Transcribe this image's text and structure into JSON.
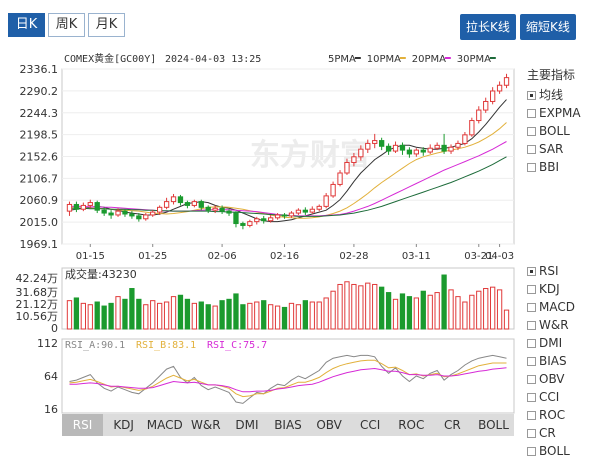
{
  "period_tabs": [
    {
      "label": "日K",
      "active": true
    },
    {
      "label": "周K",
      "active": false
    },
    {
      "label": "月K",
      "active": false
    }
  ],
  "buttons": {
    "extend": "拉长K线",
    "shorten": "缩短K线"
  },
  "header": {
    "symbol": "COMEX黄金[GC00Y]",
    "datetime": "2024-04-03 13:25"
  },
  "ma_legend": [
    {
      "label": "5PMA",
      "color": "#333333"
    },
    {
      "label": "10PMA",
      "color": "#e2b13c"
    },
    {
      "label": "20PMA",
      "color": "#d62ad6"
    },
    {
      "label": "30PMA",
      "color": "#1d6b3a"
    }
  ],
  "main_indicators": {
    "title": "主要指标",
    "items": [
      {
        "label": "均线",
        "checked": true
      },
      {
        "label": "EXPMA",
        "checked": false
      },
      {
        "label": "BOLL",
        "checked": false
      },
      {
        "label": "SAR",
        "checked": false
      },
      {
        "label": "BBI",
        "checked": false
      }
    ]
  },
  "sub_indicators": [
    {
      "label": "RSI",
      "checked": true
    },
    {
      "label": "KDJ",
      "checked": false
    },
    {
      "label": "MACD",
      "checked": false
    },
    {
      "label": "W&R",
      "checked": false
    },
    {
      "label": "DMI",
      "checked": false
    },
    {
      "label": "BIAS",
      "checked": false
    },
    {
      "label": "OBV",
      "checked": false
    },
    {
      "label": "CCI",
      "checked": false
    },
    {
      "label": "ROC",
      "checked": false
    },
    {
      "label": "CR",
      "checked": false
    },
    {
      "label": "BOLL",
      "checked": false
    }
  ],
  "bottom_tabs": [
    "RSI",
    "KDJ",
    "MACD",
    "W&R",
    "DMI",
    "BIAS",
    "OBV",
    "CCI",
    "ROC",
    "CR",
    "BOLL"
  ],
  "bottom_tab_active": "RSI",
  "volume": {
    "label": "成交量:43230",
    "ticks": [
      "42.24万",
      "31.68万",
      "21.12万",
      "10.56万",
      "0"
    ]
  },
  "rsi": {
    "legend": [
      {
        "label": "RSI_A:90.1",
        "color": "#888888"
      },
      {
        "label": "RSI_B:83.1",
        "color": "#e2b13c"
      },
      {
        "label": "RSI_C:75.7",
        "color": "#d62ad6"
      }
    ],
    "ticks": [
      "112",
      "64",
      "16"
    ]
  },
  "watermark": "东方财富",
  "chart_data": {
    "type": "candlestick",
    "y_ticks": [
      2336.1,
      2290.2,
      2244.3,
      2198.5,
      2152.6,
      2106.7,
      2060.9,
      2015.0,
      1969.1
    ],
    "ylim": [
      1969.1,
      2336.1
    ],
    "x_ticks": [
      "01-15",
      "01-25",
      "02-06",
      "02-16",
      "02-28",
      "03-11",
      "03-21",
      "04-03"
    ],
    "candles": [
      [
        2038,
        2052,
        2028,
        2058
      ],
      [
        2052,
        2042,
        2036,
        2058
      ],
      [
        2042,
        2050,
        2038,
        2056
      ],
      [
        2050,
        2056,
        2044,
        2062
      ],
      [
        2056,
        2040,
        2034,
        2060
      ],
      [
        2040,
        2034,
        2028,
        2046
      ],
      [
        2034,
        2030,
        2022,
        2040
      ],
      [
        2030,
        2038,
        2026,
        2044
      ],
      [
        2038,
        2032,
        2026,
        2042
      ],
      [
        2032,
        2028,
        2022,
        2038
      ],
      [
        2028,
        2022,
        2016,
        2034
      ],
      [
        2022,
        2030,
        2018,
        2034
      ],
      [
        2030,
        2036,
        2026,
        2040
      ],
      [
        2036,
        2046,
        2030,
        2050
      ],
      [
        2046,
        2058,
        2042,
        2066
      ],
      [
        2058,
        2068,
        2052,
        2074
      ],
      [
        2068,
        2056,
        2050,
        2072
      ],
      [
        2056,
        2050,
        2044,
        2060
      ],
      [
        2050,
        2058,
        2046,
        2062
      ],
      [
        2058,
        2046,
        2040,
        2062
      ],
      [
        2046,
        2040,
        2034,
        2050
      ],
      [
        2040,
        2044,
        2034,
        2050
      ],
      [
        2044,
        2038,
        2032,
        2050
      ],
      [
        2038,
        2034,
        2028,
        2042
      ],
      [
        2034,
        2012,
        2004,
        2038
      ],
      [
        2012,
        2008,
        2000,
        2016
      ],
      [
        2008,
        2016,
        2004,
        2020
      ],
      [
        2016,
        2022,
        2010,
        2026
      ],
      [
        2022,
        2018,
        2012,
        2028
      ],
      [
        2018,
        2024,
        2014,
        2030
      ],
      [
        2024,
        2030,
        2020,
        2034
      ],
      [
        2030,
        2028,
        2022,
        2034
      ],
      [
        2028,
        2034,
        2024,
        2038
      ],
      [
        2034,
        2040,
        2030,
        2044
      ],
      [
        2040,
        2036,
        2030,
        2046
      ],
      [
        2036,
        2042,
        2032,
        2048
      ],
      [
        2042,
        2048,
        2038,
        2052
      ],
      [
        2048,
        2070,
        2044,
        2076
      ],
      [
        2070,
        2094,
        2066,
        2100
      ],
      [
        2094,
        2118,
        2090,
        2124
      ],
      [
        2118,
        2140,
        2114,
        2148
      ],
      [
        2140,
        2152,
        2132,
        2160
      ],
      [
        2152,
        2168,
        2144,
        2176
      ],
      [
        2168,
        2180,
        2160,
        2188
      ],
      [
        2180,
        2186,
        2170,
        2200
      ],
      [
        2186,
        2174,
        2166,
        2192
      ],
      [
        2174,
        2164,
        2156,
        2180
      ],
      [
        2164,
        2176,
        2160,
        2184
      ],
      [
        2176,
        2166,
        2156,
        2182
      ],
      [
        2166,
        2158,
        2150,
        2172
      ],
      [
        2158,
        2166,
        2152,
        2170
      ],
      [
        2166,
        2162,
        2154,
        2172
      ],
      [
        2162,
        2170,
        2158,
        2178
      ],
      [
        2170,
        2176,
        2166,
        2182
      ],
      [
        2176,
        2164,
        2158,
        2200
      ],
      [
        2164,
        2172,
        2158,
        2178
      ],
      [
        2172,
        2180,
        2166,
        2186
      ],
      [
        2180,
        2198,
        2176,
        2204
      ],
      [
        2198,
        2228,
        2194,
        2234
      ],
      [
        2228,
        2250,
        2222,
        2258
      ],
      [
        2250,
        2268,
        2244,
        2276
      ],
      [
        2268,
        2290,
        2262,
        2298
      ],
      [
        2290,
        2302,
        2284,
        2310
      ],
      [
        2302,
        2318,
        2296,
        2326
      ]
    ],
    "volume": [
      21,
      23,
      19,
      18,
      20,
      17,
      19,
      24,
      22,
      30,
      22,
      18,
      21,
      19,
      20,
      24,
      25,
      22,
      19,
      20,
      18,
      17,
      21,
      22,
      26,
      18,
      19,
      20,
      21,
      18,
      17,
      16,
      19,
      18,
      21,
      20,
      20,
      23,
      28,
      33,
      35,
      33,
      32,
      34,
      33,
      31,
      27,
      22,
      26,
      24,
      23,
      28,
      25,
      27,
      40,
      29,
      24,
      20,
      25,
      28,
      30,
      31,
      29,
      14
    ],
    "ma": {
      "5PMA": [
        2040,
        2042,
        2044,
        2046,
        2048,
        2046,
        2042,
        2040,
        2036,
        2034,
        2032,
        2030,
        2030,
        2032,
        2036,
        2042,
        2048,
        2054,
        2056,
        2058,
        2056,
        2050,
        2046,
        2044,
        2040,
        2034,
        2028,
        2022,
        2018,
        2016,
        2016,
        2018,
        2020,
        2024,
        2028,
        2032,
        2036,
        2040,
        2050,
        2062,
        2080,
        2100,
        2118,
        2132,
        2146,
        2156,
        2166,
        2172,
        2176,
        2176,
        2172,
        2170,
        2168,
        2168,
        2170,
        2172,
        2176,
        2180,
        2190,
        2204,
        2220,
        2238,
        2256,
        2272
      ],
      "10PMA": [
        2045,
        2045,
        2044,
        2044,
        2044,
        2043,
        2042,
        2041,
        2040,
        2039,
        2038,
        2036,
        2034,
        2033,
        2032,
        2033,
        2035,
        2037,
        2040,
        2043,
        2046,
        2047,
        2047,
        2046,
        2044,
        2042,
        2039,
        2036,
        2033,
        2030,
        2027,
        2025,
        2024,
        2023,
        2023,
        2024,
        2026,
        2029,
        2033,
        2038,
        2045,
        2054,
        2064,
        2075,
        2087,
        2098,
        2108,
        2118,
        2128,
        2138,
        2146,
        2152,
        2156,
        2160,
        2163,
        2166,
        2169,
        2172,
        2177,
        2183,
        2191,
        2200,
        2211,
        2224
      ],
      "20PMA": [
        2048,
        2048,
        2048,
        2047,
        2047,
        2046,
        2046,
        2045,
        2044,
        2043,
        2042,
        2041,
        2040,
        2039,
        2038,
        2038,
        2038,
        2038,
        2039,
        2040,
        2041,
        2041,
        2041,
        2041,
        2040,
        2039,
        2038,
        2037,
        2035,
        2033,
        2031,
        2030,
        2029,
        2028,
        2028,
        2028,
        2028,
        2029,
        2030,
        2031,
        2034,
        2038,
        2043,
        2048,
        2054,
        2061,
        2068,
        2075,
        2082,
        2089,
        2096,
        2103,
        2110,
        2117,
        2124,
        2130,
        2136,
        2142,
        2148,
        2154,
        2161,
        2168,
        2176,
        2184
      ],
      "30PMA": [
        2044,
        2044,
        2044,
        2043,
        2043,
        2043,
        2042,
        2042,
        2042,
        2041,
        2041,
        2040,
        2040,
        2039,
        2039,
        2038,
        2038,
        2038,
        2038,
        2038,
        2038,
        2037,
        2037,
        2036,
        2036,
        2035,
        2034,
        2033,
        2032,
        2031,
        2030,
        2029,
        2028,
        2027,
        2027,
        2027,
        2027,
        2028,
        2029,
        2030,
        2032,
        2034,
        2037,
        2040,
        2044,
        2048,
        2053,
        2058,
        2063,
        2068,
        2073,
        2078,
        2083,
        2088,
        2093,
        2098,
        2104,
        2110,
        2116,
        2122,
        2129,
        2136,
        2144,
        2152
      ]
    },
    "rsi": {
      "RSI_A": [
        56,
        58,
        62,
        66,
        54,
        46,
        42,
        48,
        44,
        40,
        38,
        46,
        54,
        64,
        74,
        78,
        62,
        54,
        62,
        50,
        44,
        48,
        44,
        40,
        26,
        24,
        32,
        40,
        38,
        46,
        52,
        50,
        58,
        64,
        60,
        66,
        72,
        84,
        90,
        92,
        94,
        92,
        94,
        94,
        92,
        78,
        68,
        76,
        64,
        56,
        64,
        60,
        68,
        72,
        58,
        66,
        72,
        80,
        86,
        90,
        92,
        94,
        92,
        90
      ],
      "RSI_B": [
        54,
        55,
        57,
        59,
        56,
        52,
        48,
        49,
        47,
        45,
        43,
        45,
        49,
        55,
        61,
        65,
        61,
        57,
        59,
        55,
        51,
        51,
        49,
        46,
        38,
        34,
        35,
        38,
        38,
        42,
        46,
        47,
        51,
        55,
        55,
        58,
        62,
        69,
        75,
        79,
        82,
        84,
        86,
        87,
        87,
        82,
        76,
        77,
        72,
        66,
        67,
        64,
        66,
        68,
        63,
        64,
        67,
        71,
        75,
        79,
        81,
        83,
        83,
        83
      ],
      "RSI_C": [
        52,
        52,
        53,
        54,
        53,
        51,
        49,
        49,
        48,
        47,
        46,
        46,
        47,
        50,
        53,
        56,
        55,
        54,
        55,
        53,
        51,
        51,
        50,
        48,
        44,
        41,
        41,
        42,
        42,
        43,
        45,
        46,
        48,
        50,
        51,
        52,
        55,
        59,
        63,
        66,
        69,
        71,
        73,
        74,
        75,
        73,
        71,
        71,
        69,
        66,
        66,
        65,
        65,
        66,
        64,
        64,
        65,
        67,
        69,
        71,
        72,
        74,
        75,
        76
      ]
    }
  }
}
